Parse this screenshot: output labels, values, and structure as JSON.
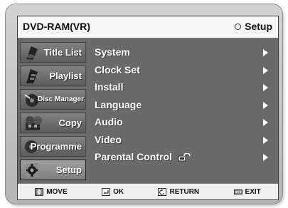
{
  "header": {
    "title": "DVD-RAM(VR)",
    "breadcrumb": "Setup"
  },
  "sidebar": {
    "items": [
      {
        "label": "Title List",
        "icon": "disc-icon",
        "active": false
      },
      {
        "label": "Playlist",
        "icon": "film-disc-icon",
        "active": false
      },
      {
        "label": "Disc Manager",
        "icon": "disc-tool-icon",
        "active": false
      },
      {
        "label": "Copy",
        "icon": "copy-discs-icon",
        "active": false
      },
      {
        "label": "Programme",
        "icon": "record-disc-icon",
        "active": false
      },
      {
        "label": "Setup",
        "icon": "gear-icon",
        "active": true
      }
    ]
  },
  "menu": {
    "items": [
      {
        "label": "System"
      },
      {
        "label": "Clock Set"
      },
      {
        "label": "Install"
      },
      {
        "label": "Language"
      },
      {
        "label": "Audio"
      },
      {
        "label": "Video"
      },
      {
        "label": "Parental Control",
        "icon": "lock-icon"
      }
    ]
  },
  "footer": {
    "move": "MOVE",
    "ok": "OK",
    "return": "RETURN",
    "exit": "EXIT"
  },
  "colors": {
    "screen_bg": "#6a6a6a",
    "bar_bg": "#f6f6f6",
    "text_light": "#ffffff"
  }
}
